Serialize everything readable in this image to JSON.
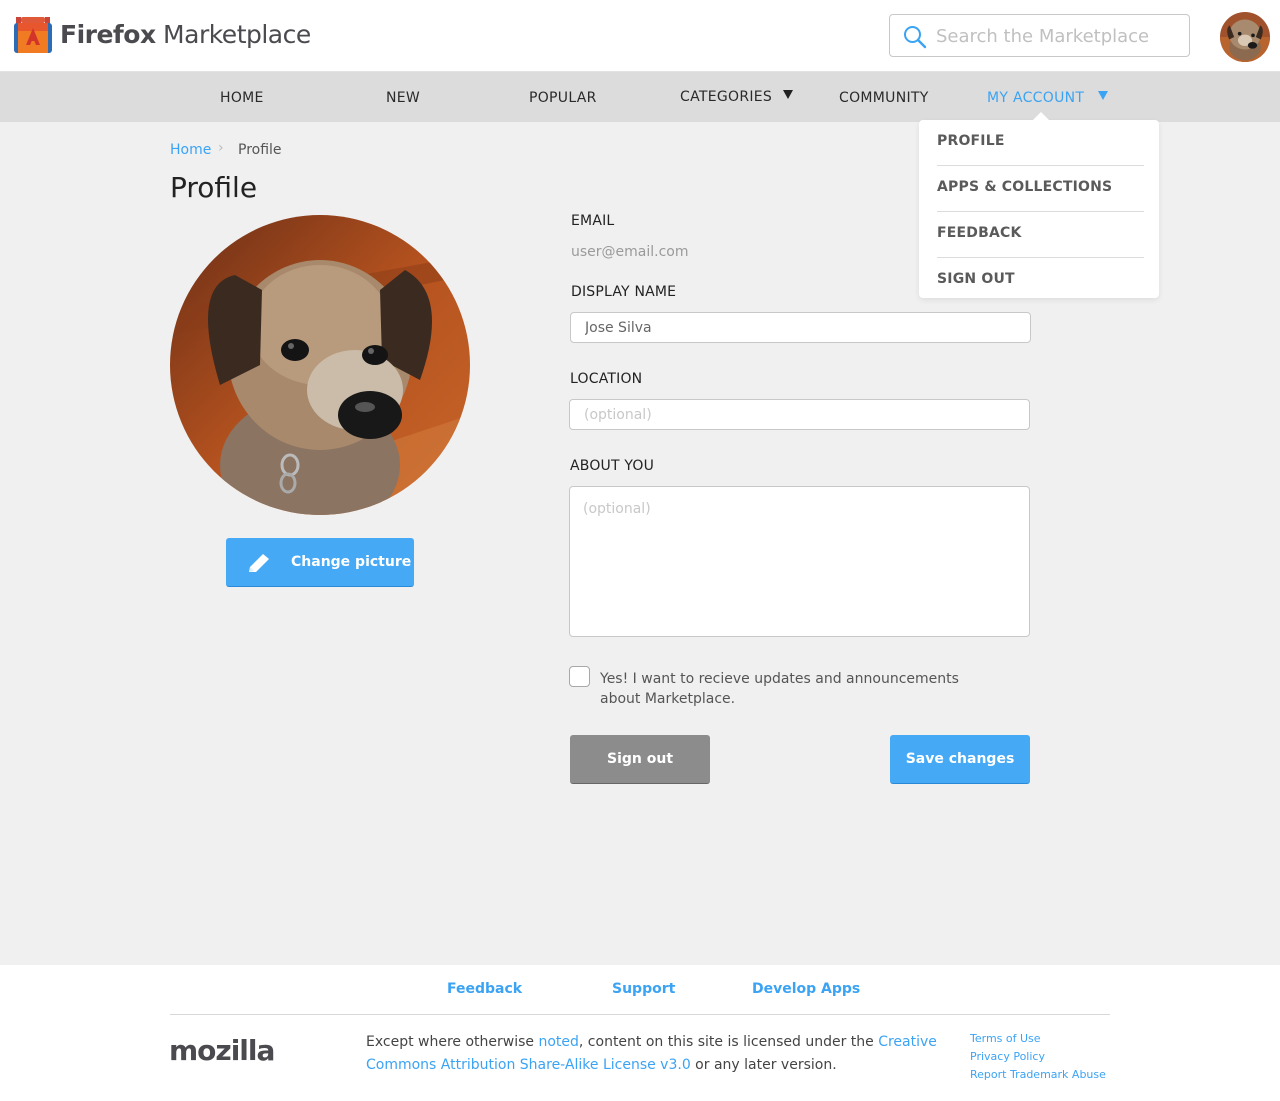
{
  "header": {
    "brand_prefix": "Firefox",
    "brand_suffix": " Marketplace",
    "search_placeholder": "Search the Marketplace",
    "logo_icon": "marketplace-bag-icon",
    "avatar_icon": "dog-avatar"
  },
  "nav": {
    "items": [
      {
        "label": "HOME"
      },
      {
        "label": "NEW"
      },
      {
        "label": "POPULAR"
      },
      {
        "label": "CATEGORIES"
      },
      {
        "label": "COMMUNITY"
      },
      {
        "label": "MY ACCOUNT"
      }
    ],
    "active_index": 5
  },
  "account_menu": {
    "items": [
      {
        "label": "PROFILE"
      },
      {
        "label": "APPS & COLLECTIONS"
      },
      {
        "label": "FEEDBACK"
      },
      {
        "label": "SIGN OUT"
      }
    ]
  },
  "breadcrumb": {
    "home": "Home",
    "current": "Profile"
  },
  "page": {
    "title": "Profile",
    "change_picture_label": "Change picture"
  },
  "form": {
    "email_label": "EMAIL",
    "email_value": "user@email.com",
    "display_name_label": "DISPLAY NAME",
    "display_name_value": "Jose Silva",
    "location_label": "LOCATION",
    "location_placeholder": "(optional)",
    "about_label": "ABOUT YOU",
    "about_placeholder": "(optional)",
    "updates_text": "Yes! I want to recieve updates and announcements about Marketplace.",
    "updates_checked": false,
    "signout_label": "Sign out",
    "save_label": "Save changes"
  },
  "footer": {
    "links": [
      {
        "label": "Feedback"
      },
      {
        "label": "Support"
      },
      {
        "label": "Develop Apps"
      }
    ],
    "mozilla": "mozilla",
    "license_before": "Except where otherwise ",
    "license_noted": "noted",
    "license_mid": ", content on this site is licensed under the ",
    "license_link": "Creative Commons Attribution Share-Alike License v3.0",
    "license_after": " or any later version.",
    "legal": [
      {
        "label": "Terms of Use"
      },
      {
        "label": "Privacy Policy"
      },
      {
        "label": "Report Trademark Abuse"
      }
    ]
  },
  "colors": {
    "accent": "#3ba3f4",
    "button_primary": "#45a9f5",
    "button_secondary": "#8c8c8c",
    "page_bg": "#f0f0f0",
    "nav_bg": "#dcdcdc"
  }
}
